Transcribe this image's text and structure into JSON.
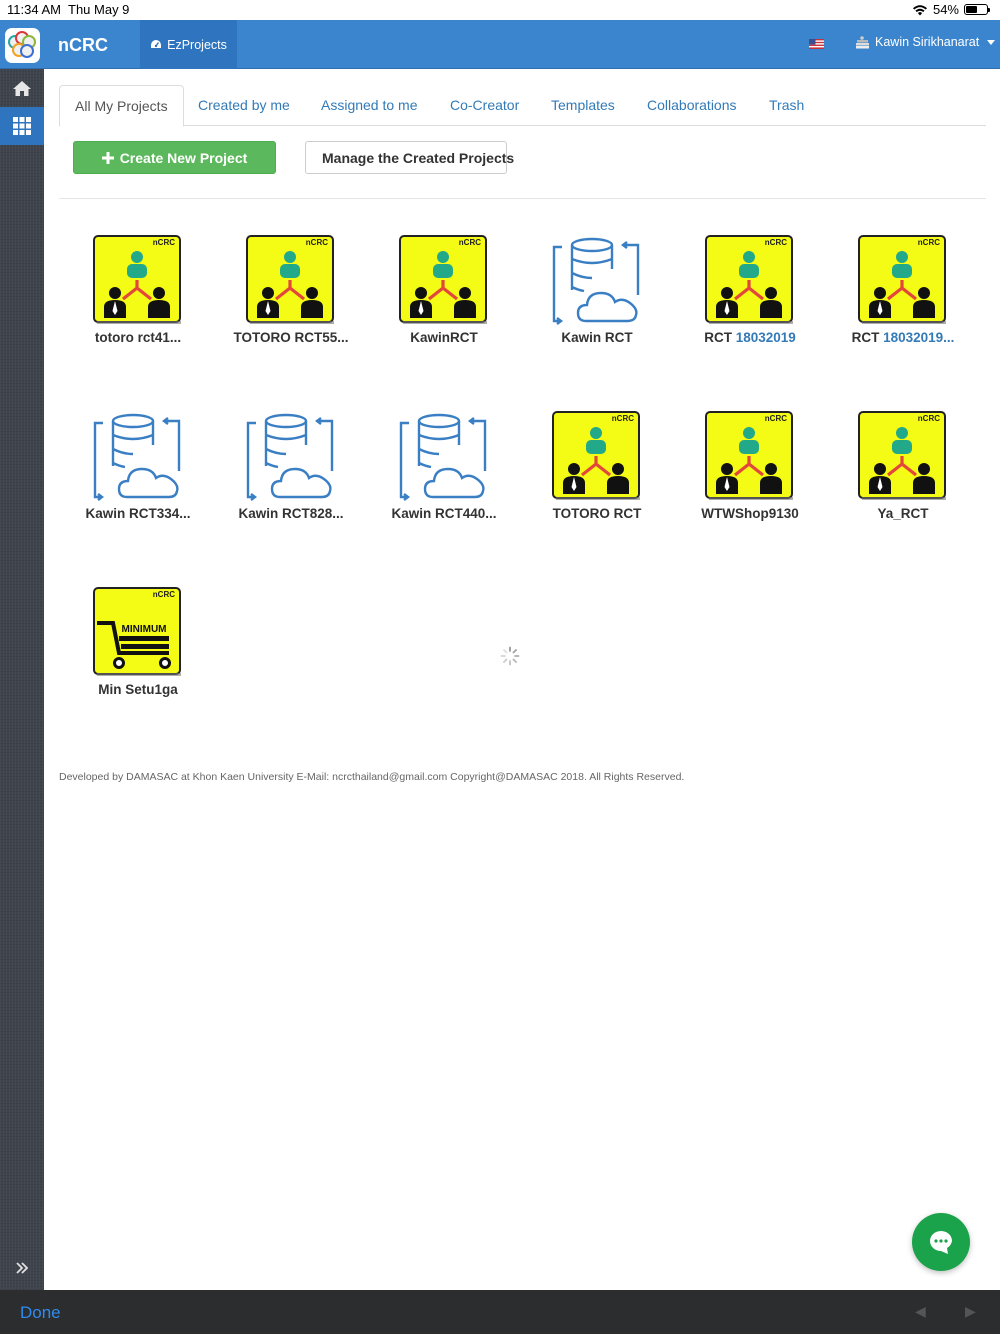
{
  "status": {
    "time": "11:34 AM",
    "date": "Thu May 9",
    "battery": "54%"
  },
  "header": {
    "brand": "nCRC",
    "ez_tab": "EzProjects",
    "user": "Kawin Sirikhanarat"
  },
  "tabs": [
    {
      "label": "All My Projects",
      "active": true
    },
    {
      "label": "Created by me"
    },
    {
      "label": "Assigned to me"
    },
    {
      "label": "Co-Creator"
    },
    {
      "label": "Templates"
    },
    {
      "label": "Collaborations"
    },
    {
      "label": "Trash"
    }
  ],
  "actions": {
    "create_label": "Create New Project",
    "manage_label": "Manage the Created Projects"
  },
  "projects": [
    {
      "name": "totoro rct41...",
      "icon": "ncrc-team-icon"
    },
    {
      "name": "TOTORO RCT55...",
      "icon": "ncrc-team-icon"
    },
    {
      "name": "KawinRCT",
      "icon": "ncrc-team-icon"
    },
    {
      "name": "Kawin RCT",
      "icon": "cloud-database-icon"
    },
    {
      "name_prefix": "RCT ",
      "name_link": "18032019",
      "icon": "ncrc-team-icon"
    },
    {
      "name_prefix": "RCT ",
      "name_link": "18032019...",
      "icon": "ncrc-team-icon"
    },
    {
      "name": "Kawin RCT334...",
      "icon": "cloud-database-icon"
    },
    {
      "name": "Kawin RCT828...",
      "icon": "cloud-database-icon"
    },
    {
      "name": "Kawin RCT440...",
      "icon": "cloud-database-icon"
    },
    {
      "name": "TOTORO RCT",
      "icon": "ncrc-team-icon"
    },
    {
      "name": "WTWShop9130",
      "icon": "ncrc-team-icon"
    },
    {
      "name": "Ya_RCT",
      "icon": "ncrc-team-icon"
    },
    {
      "name": "Min Setu1ga",
      "icon": "minimum-cart-icon"
    }
  ],
  "icon_text": {
    "badge": "nCRC",
    "minimum": "MINIMUM"
  },
  "footer": "Developed by DAMASAC at Khon Kaen University E-Mail: ncrcthailand@gmail.com Copyright@DAMASAC 2018. All Rights Reserved.",
  "bottom": {
    "done": "Done"
  },
  "colors": {
    "nav": "#3b85cf",
    "green": "#5cb85c",
    "link": "#337ab7",
    "icon_yellow": "#f4fb14"
  }
}
